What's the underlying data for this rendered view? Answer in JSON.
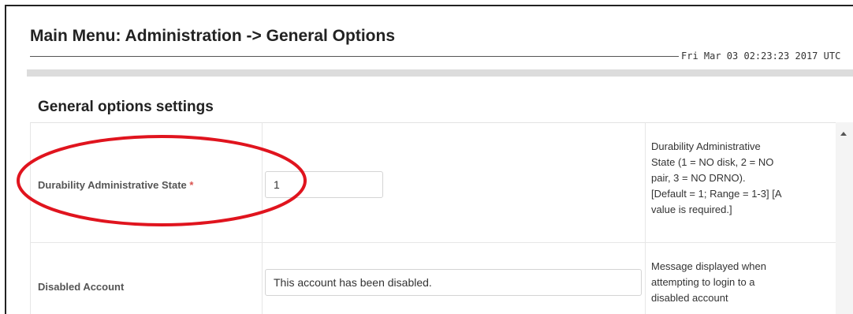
{
  "header": {
    "title": "Main Menu: Administration -> General Options",
    "timestamp": "Fri Mar 03 02:23:23 2017 UTC"
  },
  "section": {
    "title": "General options settings"
  },
  "settings": [
    {
      "label": "Durability Administrative State",
      "required_mark": "*",
      "value": "1",
      "description": "Durability Administrative\nState (1 = NO disk, 2 = NO\npair, 3 = NO DRNO).\n[Default = 1; Range = 1-3] [A\nvalue is required.]"
    },
    {
      "label": "Disabled Account",
      "value": "This account has been disabled.",
      "description": "Message displayed when\nattempting to login to a\ndisabled account"
    }
  ],
  "annotation": {
    "highlight_color": "#e0141e"
  },
  "icons": {
    "scroll_up": "scroll-up-arrow-icon"
  }
}
